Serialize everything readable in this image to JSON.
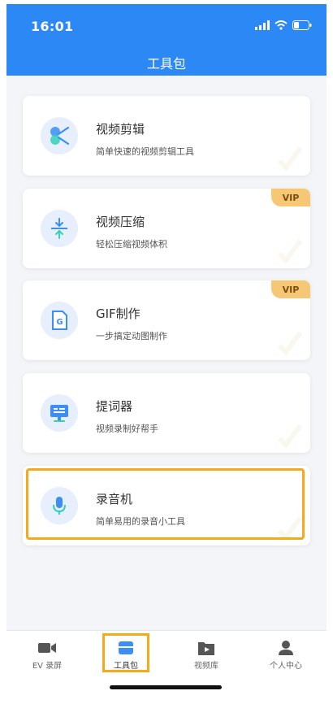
{
  "status": {
    "time": "16:01"
  },
  "header": {
    "title": "工具包"
  },
  "tools": [
    {
      "title": "视频剪辑",
      "subtitle": "简单快速的视频剪辑工具",
      "badge": "",
      "icon": "scissors-icon"
    },
    {
      "title": "视频压缩",
      "subtitle": "轻松压缩视频体积",
      "badge": "VIP",
      "icon": "compress-icon"
    },
    {
      "title": "GIF制作",
      "subtitle": "一步搞定动图制作",
      "badge": "VIP",
      "icon": "gif-file-icon"
    },
    {
      "title": "提词器",
      "subtitle": "视频录制好帮手",
      "badge": "",
      "icon": "teleprompter-icon"
    },
    {
      "title": "录音机",
      "subtitle": "简单易用的录音小工具",
      "badge": "",
      "icon": "microphone-icon"
    }
  ],
  "tabbar": {
    "items": [
      {
        "label": "EV 录屏",
        "icon": "video-camera-icon",
        "active": false
      },
      {
        "label": "工具包",
        "icon": "toolbox-icon",
        "active": true
      },
      {
        "label": "视频库",
        "icon": "video-library-icon",
        "active": false
      },
      {
        "label": "个人中心",
        "icon": "person-icon",
        "active": false
      }
    ]
  },
  "colors": {
    "header": "#2b88f5",
    "accent_icon": "#3a8ef6",
    "highlight": "#f7a81b",
    "vip_badge": "#f6c774"
  }
}
